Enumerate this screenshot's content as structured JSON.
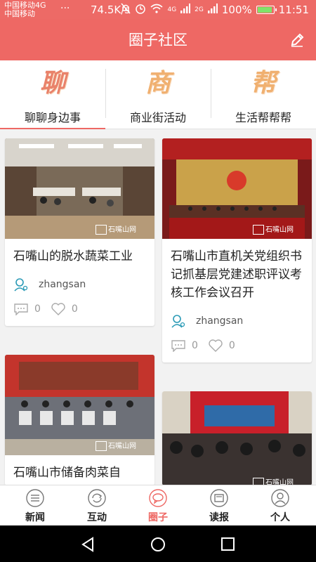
{
  "status_bar": {
    "carrier_primary": "中国移动4G",
    "carrier_secondary": "中国移动",
    "dots": "···",
    "network_speed": "74.5K/s",
    "signal_1": "4G",
    "signal_2": "2G",
    "battery": "100%",
    "time": "11:51"
  },
  "header": {
    "title": "圈子社区",
    "edit_icon": "pencil-icon"
  },
  "categories": [
    {
      "glyph": "聊",
      "label": "聊聊身边事"
    },
    {
      "glyph": "商",
      "label": "商业街活动"
    },
    {
      "glyph": "帮",
      "label": "生活帮帮帮"
    }
  ],
  "watermark": "石嘴山网",
  "posts": [
    {
      "title": "石嘴山的脱水蔬菜工业",
      "author": "zhangsan",
      "comments": "0",
      "likes": "0"
    },
    {
      "title": "石嘴山市直机关党组织书记抓基层党建述职评议考核工作会议召开",
      "author": "zhangsan",
      "comments": "0",
      "likes": "0"
    },
    {
      "title": "石嘴山市储备肉菜自",
      "author": "",
      "comments": "",
      "likes": ""
    },
    {
      "title": "",
      "author": "",
      "comments": "",
      "likes": ""
    }
  ],
  "bottom_nav": [
    {
      "label": "新闻",
      "icon": "news-icon"
    },
    {
      "label": "互动",
      "icon": "refresh-icon"
    },
    {
      "label": "圈子",
      "icon": "chat-bubble-icon"
    },
    {
      "label": "读报",
      "icon": "newspaper-icon"
    },
    {
      "label": "个人",
      "icon": "person-icon"
    }
  ],
  "colors": {
    "accent": "#ee6864",
    "battery": "#7fe36a"
  }
}
